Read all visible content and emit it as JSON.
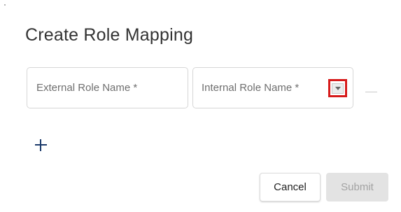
{
  "dialog": {
    "title": "Create Role Mapping"
  },
  "form": {
    "external_role": {
      "placeholder": "External Role Name *",
      "value": ""
    },
    "internal_role": {
      "placeholder": "Internal Role Name *",
      "value": "",
      "dropdown_icon": "caret-down-icon",
      "highlight_color": "#d61a1a"
    },
    "remove_icon": "minus-icon",
    "add_icon": "plus-icon",
    "add_color": "#1b3a6b"
  },
  "actions": {
    "cancel_label": "Cancel",
    "submit_label": "Submit",
    "submit_disabled": true
  }
}
